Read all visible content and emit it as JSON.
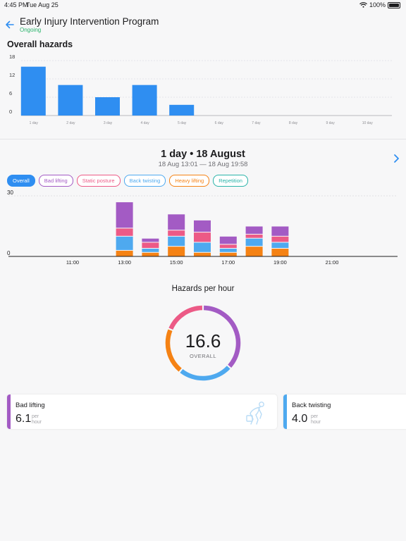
{
  "status_bar": {
    "time": "4:45 PM",
    "date": "Tue Aug 25",
    "battery": "100%"
  },
  "header": {
    "title": "Early Injury Intervention Program",
    "status": "Ongoing"
  },
  "overall": {
    "title": "Overall hazards",
    "chart_data": {
      "type": "bar",
      "categories": [
        "1 day",
        "2 day",
        "3 day",
        "4 day",
        "5 day",
        "6 day",
        "7 day",
        "8 day",
        "9 day",
        "10 day"
      ],
      "values": [
        16,
        10,
        6,
        10,
        3.5,
        0,
        0,
        0,
        0,
        0
      ],
      "y_ticks": [
        "0",
        "6",
        "12",
        "18"
      ],
      "ylim": [
        0,
        18
      ],
      "grid": true,
      "color": "#2f8ef1"
    }
  },
  "period": {
    "title": "1 day • 18 August",
    "range": "18 Aug 13:01 — 18 Aug 19:58"
  },
  "filters": [
    {
      "label": "Overall",
      "color": "#2f8ef1",
      "active": true
    },
    {
      "label": "Bad lifting",
      "color": "#a35bc4",
      "active": false
    },
    {
      "label": "Static posture",
      "color": "#ec5a86",
      "active": false
    },
    {
      "label": "Back twisting",
      "color": "#4ea9ef",
      "active": false
    },
    {
      "label": "Heavy lifting",
      "color": "#f58214",
      "active": false
    },
    {
      "label": "Repetition",
      "color": "#2ab3a9",
      "active": false
    }
  ],
  "hourly": {
    "chart_data": {
      "type": "bar",
      "stacked": true,
      "x_ticks": [
        "11:00",
        "13:00",
        "15:00",
        "17:00",
        "19:00",
        "21:00"
      ],
      "y_ticks": [
        "0",
        "30"
      ],
      "ylim": [
        0,
        30
      ],
      "slots": [
        "13:00",
        "14:00",
        "15:00",
        "16:00",
        "17:00",
        "18:00",
        "19:00"
      ],
      "series": [
        {
          "key": "heavy",
          "color": "#f58214",
          "values": [
            3,
            2,
            5,
            2,
            2,
            5,
            4
          ]
        },
        {
          "key": "twist",
          "color": "#4ea9ef",
          "values": [
            7,
            2,
            5,
            5,
            2,
            4,
            3
          ]
        },
        {
          "key": "static",
          "color": "#ec5a86",
          "values": [
            4,
            3,
            3,
            5,
            2,
            2,
            3
          ]
        },
        {
          "key": "badlift",
          "color": "#a35bc4",
          "values": [
            13,
            2,
            8,
            6,
            4,
            4,
            5
          ]
        }
      ]
    }
  },
  "hazards_per_hour": {
    "title": "Hazards per hour",
    "value": "16.6",
    "label": "OVERALL",
    "chart_data": {
      "type": "pie",
      "donut": true,
      "series": [
        {
          "key": "badlift",
          "value": 6.1,
          "color": "#a35bc4"
        },
        {
          "key": "twist",
          "value": 4.0,
          "color": "#4ea9ef"
        },
        {
          "key": "heavy",
          "value": 3.4,
          "color": "#f58214"
        },
        {
          "key": "static",
          "value": 3.1,
          "color": "#ec5a86"
        }
      ]
    }
  },
  "cards": [
    {
      "label": "Bad lifting",
      "value": "6.1",
      "unit_top": "per",
      "unit_bottom": "hour",
      "color": "#a35bc4",
      "icon": "bad-lifting-figure"
    },
    {
      "label": "Back twisting",
      "value": "4.0",
      "unit_top": "per",
      "unit_bottom": "hour",
      "color": "#4ea9ef",
      "icon": ""
    }
  ]
}
